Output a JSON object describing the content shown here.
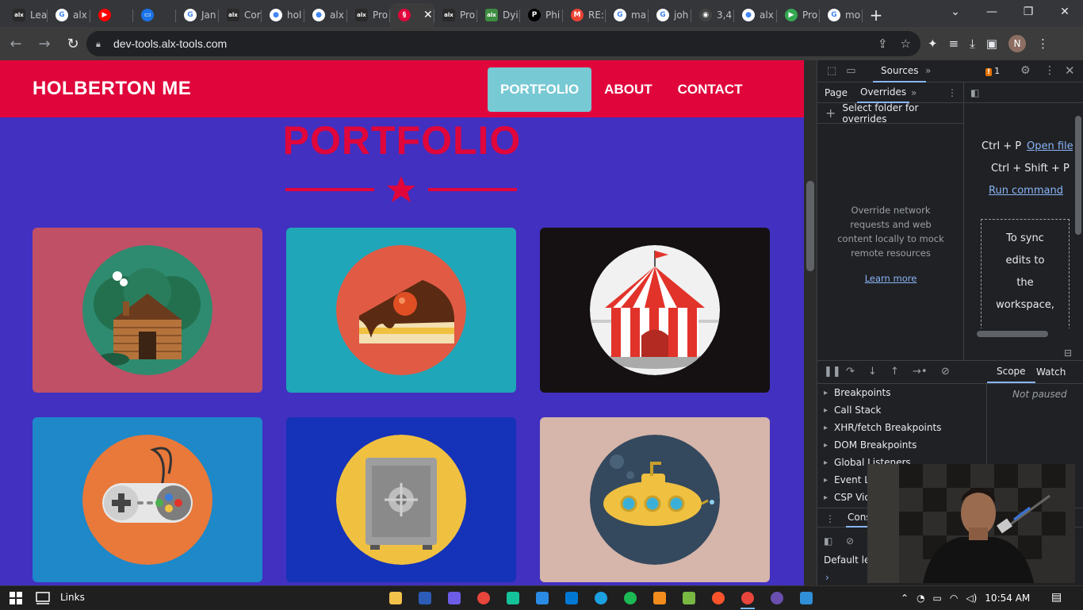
{
  "browser": {
    "tabs": [
      {
        "label": "Lea",
        "icon": "alx-icon",
        "color": "#2a2a2a"
      },
      {
        "label": "alx",
        "icon": "google-icon",
        "color": "#ffffff"
      },
      {
        "label": "",
        "icon": "youtube-icon",
        "color": "#ff0000"
      },
      {
        "label": "",
        "icon": "screen-icon",
        "color": "#1a73e8"
      },
      {
        "label": "Jan",
        "icon": "google-icon",
        "color": "#ffffff"
      },
      {
        "label": "Cor",
        "icon": "alx-icon",
        "color": "#2a2a2a"
      },
      {
        "label": "hol",
        "icon": "github-icon",
        "color": "#ffffff"
      },
      {
        "label": "alx",
        "icon": "github-icon",
        "color": "#ffffff"
      },
      {
        "label": "Pro",
        "icon": "alx-icon",
        "color": "#2a2a2a"
      },
      {
        "label": "",
        "icon": "holberton-icon",
        "color": "#e0063b",
        "active": true
      },
      {
        "label": "Pro",
        "icon": "alx-icon",
        "color": "#2a2a2a"
      },
      {
        "label": "Dyi",
        "icon": "alx-green-icon",
        "color": "#3c8d40"
      },
      {
        "label": "Phi",
        "icon": "p-icon",
        "color": "#000000"
      },
      {
        "label": "RE:",
        "icon": "gmail-icon",
        "color": "#ea4335"
      },
      {
        "label": "ma",
        "icon": "google-icon",
        "color": "#ffffff"
      },
      {
        "label": "joh",
        "icon": "google-icon",
        "color": "#ffffff"
      },
      {
        "label": "3,4",
        "icon": "account-icon",
        "color": "#444444"
      },
      {
        "label": "alx",
        "icon": "github-icon",
        "color": "#ffffff"
      },
      {
        "label": "Pro",
        "icon": "play-icon",
        "color": "#34a853"
      },
      {
        "label": "mo",
        "icon": "google-icon",
        "color": "#ffffff"
      }
    ],
    "tab_close": "✕",
    "new_tab": "+",
    "url": "dev-tools.alx-tools.com",
    "profile_initial": "N"
  },
  "site": {
    "brand": "HOLBERTON ME",
    "nav": [
      {
        "label": "PORTFOLIO",
        "active": true
      },
      {
        "label": "ABOUT",
        "active": false
      },
      {
        "label": "CONTACT",
        "active": false
      }
    ],
    "portfolio_title": "PORTFOLIO",
    "colors": {
      "header": "#e0063b",
      "background": "#4230c0",
      "nav_active": "#77c9d4"
    },
    "cards": [
      {
        "icon": "cabin-icon",
        "bg": "#c05066"
      },
      {
        "icon": "cake-icon",
        "bg": "#1fa6b8"
      },
      {
        "icon": "circus-tent-icon",
        "bg": "#151112"
      },
      {
        "icon": "game-controller-icon",
        "bg": "#1e88c9"
      },
      {
        "icon": "safe-icon",
        "bg": "#1533b8"
      },
      {
        "icon": "submarine-icon",
        "bg": "#d6b5aa"
      }
    ]
  },
  "devtools": {
    "main_tab": "Sources",
    "warnings": "1",
    "nav_tabs": [
      "Page",
      "Overrides"
    ],
    "select_folder": "Select folder for overrides",
    "override_desc": "Override network requests and web content locally to mock remote resources",
    "learn_more": "Learn more",
    "shortcuts": [
      {
        "keys": "Ctrl + P",
        "action": "Open file"
      },
      {
        "keys": "Ctrl + Shift + P",
        "action": "Run command"
      }
    ],
    "sync_text": [
      "To sync",
      "edits to",
      "the",
      "workspace,"
    ],
    "scope_tab": "Scope",
    "watch_tab": "Watch",
    "not_paused": "Not paused",
    "sections": [
      "Breakpoints",
      "Call Stack",
      "XHR/fetch Breakpoints",
      "DOM Breakpoints",
      "Global Listeners",
      "Event Listener Breakpoints",
      "CSP Violation Breakpoints"
    ],
    "console_tab": "Console",
    "console_level": "Default levels",
    "console_prompt": "›"
  },
  "taskbar": {
    "links": "Links",
    "time": "10:54 AM",
    "apps": [
      {
        "icon": "file-explorer-icon",
        "color": "#f2c24a"
      },
      {
        "icon": "word-icon",
        "color": "#2b5cb8"
      },
      {
        "icon": "video-editor-icon",
        "color": "#6c5ce7"
      },
      {
        "icon": "chrome-icon",
        "color": "#e8453c"
      },
      {
        "icon": "grammarly-icon",
        "color": "#15c39a"
      },
      {
        "icon": "mail-icon",
        "color": "#2a8ae6"
      },
      {
        "icon": "store-icon",
        "color": "#0078d4"
      },
      {
        "icon": "edge-icon",
        "color": "#1ba1e2"
      },
      {
        "icon": "spotify-icon",
        "color": "#1db954"
      },
      {
        "icon": "vlc-icon",
        "color": "#f28c1c"
      },
      {
        "icon": "utorrent-icon",
        "color": "#78b843"
      },
      {
        "icon": "brave-icon",
        "color": "#fb542b"
      },
      {
        "icon": "chrome-active-icon",
        "color": "#e8453c",
        "active": true
      },
      {
        "icon": "obs-icon",
        "color": "#6a4fb0"
      },
      {
        "icon": "snip-icon",
        "color": "#2f8fd8"
      }
    ]
  }
}
